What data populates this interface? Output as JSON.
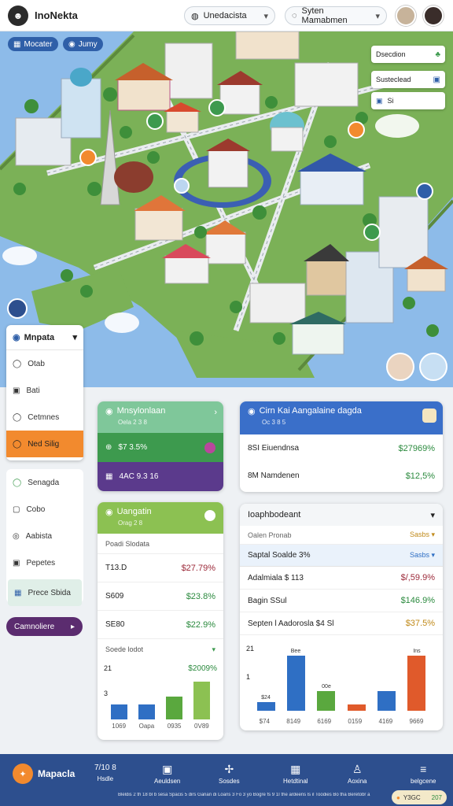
{
  "header": {
    "title": "InoNekta",
    "dropdown1": "Unedacista",
    "dropdown2": "Syten Mamabmen"
  },
  "map_chips": [
    {
      "label": "Mocater",
      "color": "#2f5fa8"
    },
    {
      "label": "Jumy",
      "color": "#2f5fa8"
    }
  ],
  "map_cards": [
    {
      "label": "Dsecdion",
      "icon": "♣"
    },
    {
      "label": "Susteclead",
      "icon": "▣"
    },
    {
      "label": "Si",
      "icon": "▣"
    }
  ],
  "side_menu": {
    "title": "Mnpata",
    "items": [
      {
        "label": "Otab",
        "icon": "◯"
      },
      {
        "label": "Bati",
        "icon": "▣"
      },
      {
        "label": "Cetmnes",
        "icon": "◯"
      },
      {
        "label": "Ned Silig",
        "icon": "◯"
      }
    ]
  },
  "side_menu2": {
    "items": [
      {
        "label": "Senagda",
        "icon": "◯"
      },
      {
        "label": "Cobo",
        "icon": "▢"
      },
      {
        "label": "Aabista",
        "icon": "◎"
      },
      {
        "label": "Pepetes",
        "icon": "▣"
      },
      {
        "label": "Prece Sbida",
        "icon": "▦"
      }
    ],
    "button": "Camnoliere"
  },
  "card_green": {
    "title": "Mnsylonlaan",
    "subtitle": "Oela 2 3 8",
    "row1": "$7 3.5%",
    "row2": "4AC 9.3 16",
    "colors": {
      "head": "#7fc79a",
      "mid": "#3d9a4e",
      "bot": "#5b3a8c"
    }
  },
  "card_blue": {
    "title": "Cirn Kai Aangalaine dagda",
    "subtitle": "Oc 3 8 5",
    "rows": [
      {
        "label": "8SI Eiuendnsa",
        "value": "$27969%"
      },
      {
        "label": "8M Namdenen",
        "value": "$12,5%"
      }
    ]
  },
  "card_lime": {
    "title": "Uangatin",
    "subtitle": "Orag 2 8",
    "table_title": "Poadi Slodata",
    "rows": [
      {
        "label": "T13.D",
        "value": "$27.79%",
        "color": "#9c2a3a"
      },
      {
        "label": "S609",
        "value": "$23.8%",
        "color": "#2b8a3e"
      },
      {
        "label": "SE80",
        "value": "$22.9%",
        "color": "#2b8a3e"
      }
    ],
    "select_label": "Soede lodot",
    "chart_y_top": "21",
    "chart_value": "$2009%",
    "chart_y_bottom": "3",
    "x_labels": [
      "1069",
      "Oapa",
      "0935",
      "0V89"
    ]
  },
  "card_table": {
    "title": "Ioaphbodeant",
    "header_left": "Oalen Pronab",
    "header_right": "Sasbs",
    "rows": [
      {
        "label": "Saptal Soalde  3%",
        "value": "Sasbs",
        "color": "#2f6fc4"
      },
      {
        "label": "Adalmiala  $ 113",
        "value": "$/,59.9%",
        "color": "#9c2a3a"
      },
      {
        "label": "Bagin SSul",
        "value": "$146.9%",
        "color": "#2b8a3e"
      },
      {
        "label": "Septen l Aadorosla  $4 Sl",
        "value": "$37.5%",
        "color": "#c08a1a"
      }
    ],
    "chart_y_top": "21",
    "chart_y_mid": "1",
    "x_labels": [
      "$74",
      "8149",
      "6169",
      "0159",
      "4169",
      "9669"
    ],
    "bar_labels": [
      "$24",
      "Bee",
      "00e",
      "",
      "",
      "Ins"
    ]
  },
  "bottom_nav": {
    "brand": "Mapacla",
    "stat": "7/10 8",
    "stat_sub": "Hsdle",
    "items": [
      {
        "label": "Aeuldsen",
        "icon": "▣"
      },
      {
        "label": "Sosdes",
        "icon": "✢"
      },
      {
        "label": "Hetdtinal",
        "icon": "▦"
      },
      {
        "label": "Aoxina",
        "icon": "♙"
      },
      {
        "label": "belgcene",
        "icon": "≡"
      }
    ],
    "footer": "Bleldis 2 th 18 bl b sesa Spacis 5 dirs Ganan di Loans 3 Fo 3 yo Bogre fs 9 1I the ardeens ls il Toodies Bo tha Beretobr a",
    "badge": "Y3GC",
    "badge_num": "207"
  },
  "chart_data": [
    {
      "type": "bar",
      "categories": [
        "1069",
        "Oapa",
        "0935",
        "0V89"
      ],
      "values": [
        7,
        7,
        11,
        18
      ],
      "colors": [
        "#2f6fc4",
        "#2f6fc4",
        "#5aa83e",
        "#8cc152"
      ]
    },
    {
      "type": "bar",
      "categories": [
        "8149",
        "6169",
        "0159",
        "4169",
        "9669"
      ],
      "values": [
        4,
        25,
        9,
        3,
        9,
        25
      ],
      "colors": [
        "#2f6fc4",
        "#2f6fc4",
        "#5aa83e",
        "#e05a2b",
        "#2f6fc4",
        "#e05a2b"
      ]
    }
  ]
}
